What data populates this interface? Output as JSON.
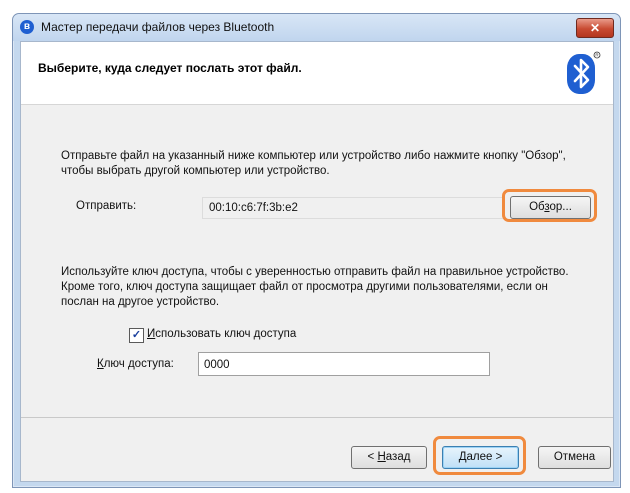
{
  "window": {
    "title": "Мастер передачи файлов через Bluetooth",
    "close_label": "✕"
  },
  "header": {
    "heading": "Выберите, куда следует послать этот файл.",
    "logo_icon": "bluetooth-icon",
    "logo_color": "#1f5fd1"
  },
  "send": {
    "description": "Отправьте файл на указанный ниже компьютер или устройство либо нажмите кнопку \"Обзор\", чтобы выбрать другой компьютер или устройство.",
    "label": "Отправить:",
    "value": "00:10:c6:7f:3b:e2",
    "browse_pre": "Об",
    "browse_u": "з",
    "browse_post": "ор..."
  },
  "passkey": {
    "description": "Используйте ключ доступа, чтобы с уверенностью отправить файл на правильное устройство. Кроме того, ключ доступа защищает файл от просмотра другими пользователями, если он послан на другое устройство.",
    "checkbox_checked": "✓",
    "checkbox_u": "И",
    "checkbox_rest": "спользовать ключ доступа",
    "key_u": "К",
    "key_rest": "люч доступа:",
    "key_value": "0000"
  },
  "buttons": {
    "back_pre": "< ",
    "back_u": "Н",
    "back_post": "азад",
    "next_u": "Д",
    "next_post": "алее >",
    "cancel": "Отмена"
  },
  "highlight_color": "#f08a3e"
}
